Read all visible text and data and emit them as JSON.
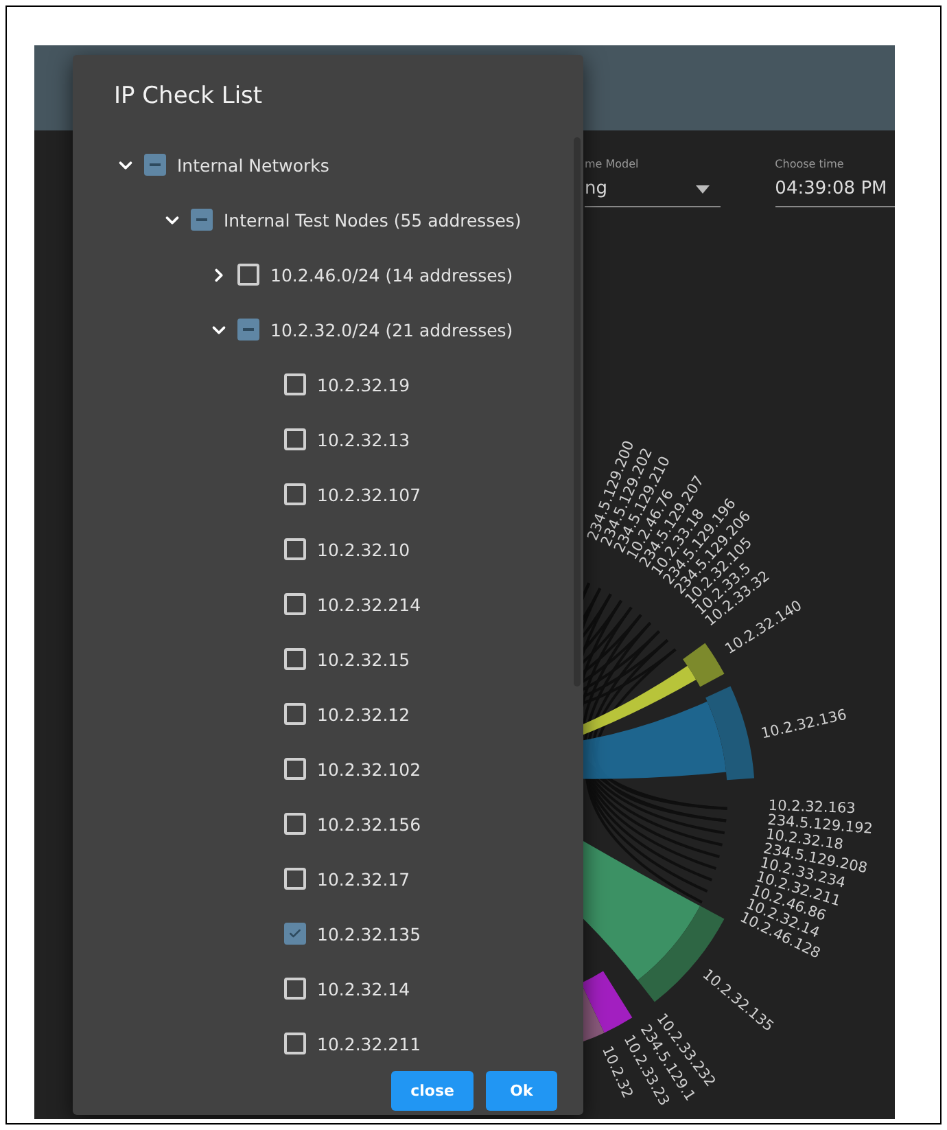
{
  "dialog": {
    "title": "IP Check List",
    "tree": [
      {
        "label": "Internal Networks",
        "checked": false,
        "indeterminate": true,
        "expanded": true,
        "children": [
          {
            "label": "Internal Test Nodes (55 addresses)",
            "checked": false,
            "indeterminate": true,
            "expanded": true,
            "children": [
              {
                "label": "10.2.46.0/24 (14 addresses)",
                "checked": false,
                "indeterminate": false,
                "expanded": false
              },
              {
                "label": "10.2.32.0/24 (21 addresses)",
                "checked": false,
                "indeterminate": true,
                "expanded": true,
                "children": [
                  {
                    "label": "10.2.32.19",
                    "checked": false
                  },
                  {
                    "label": "10.2.32.13",
                    "checked": false
                  },
                  {
                    "label": "10.2.32.107",
                    "checked": false
                  },
                  {
                    "label": "10.2.32.10",
                    "checked": false
                  },
                  {
                    "label": "10.2.32.214",
                    "checked": false
                  },
                  {
                    "label": "10.2.32.15",
                    "checked": false
                  },
                  {
                    "label": "10.2.32.12",
                    "checked": false
                  },
                  {
                    "label": "10.2.32.102",
                    "checked": false
                  },
                  {
                    "label": "10.2.32.156",
                    "checked": false
                  },
                  {
                    "label": "10.2.32.17",
                    "checked": false
                  },
                  {
                    "label": "10.2.32.135",
                    "checked": true
                  },
                  {
                    "label": "10.2.32.14",
                    "checked": false
                  },
                  {
                    "label": "10.2.32.211",
                    "checked": false
                  }
                ]
              }
            ]
          }
        ]
      }
    ],
    "buttons": [
      "close",
      "Ok"
    ]
  },
  "fields": [
    {
      "label": "me Model",
      "value": "ng",
      "kind": "select"
    },
    {
      "label": "Choose time",
      "value": "04:39:08 PM",
      "kind": "text"
    }
  ],
  "chord_labels": [
    "234.5.129.200",
    "234.5.129.202",
    "234.5.129.210",
    "10.2.46.76",
    "234.5.129.207",
    "10.2.33.18",
    "234.5.129.196",
    "234.5.129.206",
    "10.2.32.105",
    "10.2.33.5",
    "10.2.33.32",
    "10.2.32.140",
    "10.2.32.136",
    "10.2.32.163",
    "234.5.129.192",
    "10.2.32.18",
    "234.5.129.208",
    "10.2.33.234",
    "10.2.32.211",
    "10.2.46.86",
    "10.2.32.14",
    "10.2.46.128",
    "10.2.32.135",
    "10.2.33.232",
    "234.5.129.1",
    "10.2.33.23",
    "10.2.32"
  ]
}
